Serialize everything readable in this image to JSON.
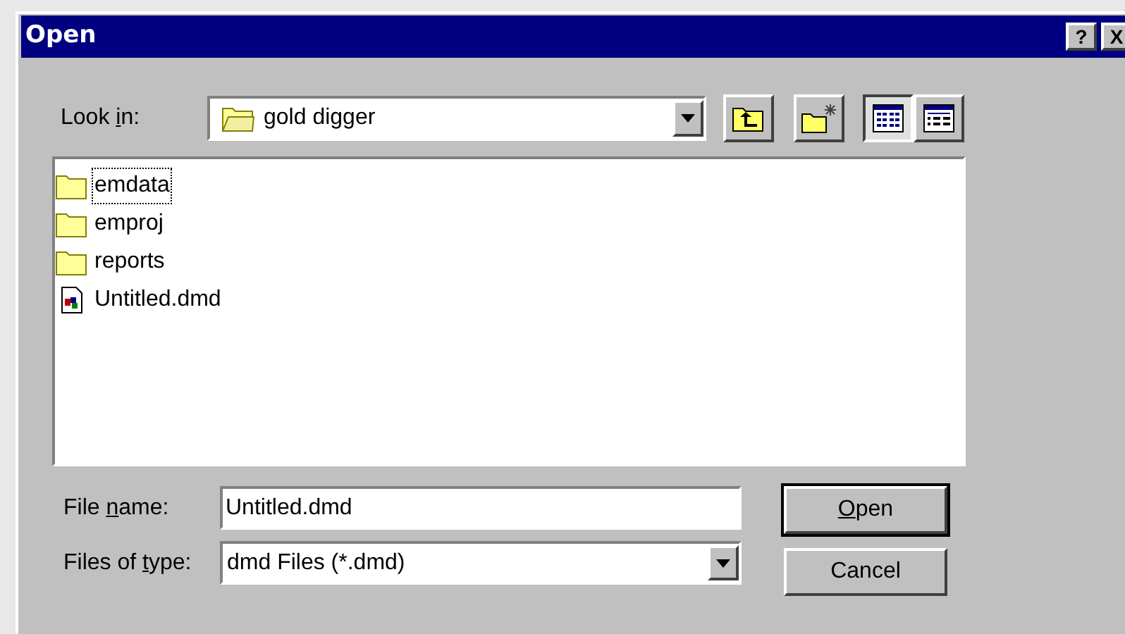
{
  "window": {
    "title": "Open",
    "help": "?",
    "close": "X"
  },
  "look_in": {
    "label": {
      "before": "Look ",
      "key": "i",
      "after": "n:"
    },
    "value": "gold digger"
  },
  "views": [
    {
      "kind": "list",
      "selected": true
    },
    {
      "kind": "details",
      "selected": false
    }
  ],
  "files": [
    {
      "name": "emdata",
      "kind": "folder",
      "focused": true
    },
    {
      "name": "emproj",
      "kind": "folder",
      "focused": false
    },
    {
      "name": "reports",
      "kind": "folder",
      "focused": false
    },
    {
      "name": "Untitled.dmd",
      "kind": "file",
      "focused": false
    }
  ],
  "file_name": {
    "label": {
      "before": "File ",
      "key": "n",
      "after": "ame:"
    },
    "value": "Untitled.dmd"
  },
  "file_type": {
    "label": {
      "before": "Files of ",
      "key": "t",
      "after": "ype:"
    },
    "value": "dmd Files (*.dmd)"
  },
  "buttons": [
    {
      "label": {
        "key": "O",
        "after": "pen"
      },
      "default": true
    },
    {
      "label": {
        "before": "Cancel"
      },
      "default": false
    }
  ]
}
